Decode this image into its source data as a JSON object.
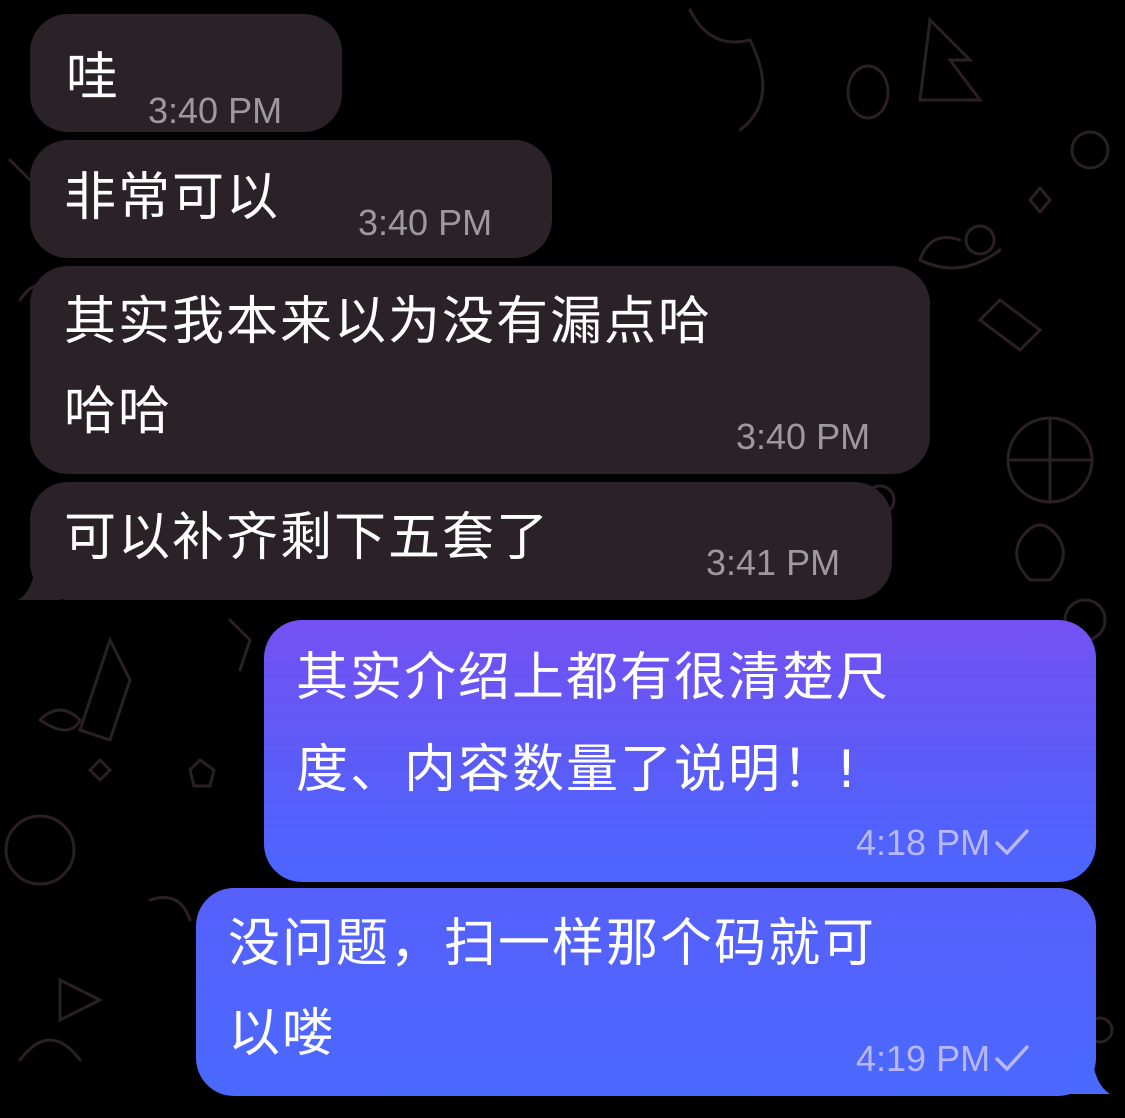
{
  "messages": [
    {
      "direction": "incoming",
      "lines": [
        "哇"
      ],
      "time": "3:40 PM"
    },
    {
      "direction": "incoming",
      "lines": [
        "非常可以"
      ],
      "time": "3:40 PM"
    },
    {
      "direction": "incoming",
      "lines": [
        "其实我本来以为没有漏点哈",
        "哈哈"
      ],
      "time": "3:40 PM"
    },
    {
      "direction": "incoming",
      "lines": [
        "可以补齐剩下五套了"
      ],
      "time": "3:41 PM"
    },
    {
      "direction": "outgoing",
      "lines": [
        "其实介绍上都有很清楚尺",
        "度、内容数量了说明！!"
      ],
      "time": "4:18 PM",
      "status": "sent-check-icon"
    },
    {
      "direction": "outgoing",
      "lines": [
        "没问题，扫一样那个码就可",
        "以喽"
      ],
      "time": "4:19 PM",
      "status": "sent-check-icon"
    }
  ],
  "colors": {
    "background": "#000000",
    "incoming_bubble": "#2a2226",
    "outgoing_bubble_top": "#7451f2",
    "outgoing_bubble_bottom": "#4c66ff",
    "incoming_time": "#9d9a9c",
    "outgoing_time": "#b9b8fb"
  }
}
